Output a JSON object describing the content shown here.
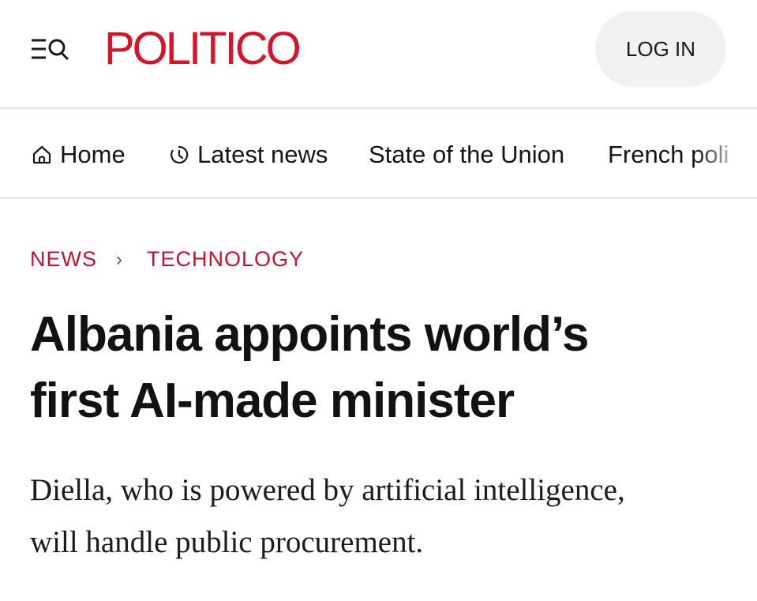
{
  "header": {
    "menu_icon": "menu-search-icon",
    "logo": "POLITICO",
    "login_label": "LOG IN",
    "brand_color": "#d5142a"
  },
  "nav": {
    "items": [
      {
        "label": "Home",
        "icon": "home-icon"
      },
      {
        "label": "Latest news",
        "icon": "clock-icon"
      },
      {
        "label": "State of the Union"
      },
      {
        "label": "French poli"
      }
    ]
  },
  "breadcrumb": {
    "section": "NEWS",
    "separator": "›",
    "subsection": "TECHNOLOGY",
    "color": "#c8102e"
  },
  "article": {
    "headline_line1": "Albania appoints world’s",
    "headline_line2": "first AI-made minister",
    "dek_line1": "Diella, who is powered by artificial intelligence,",
    "dek_line2": "will handle public procurement."
  }
}
